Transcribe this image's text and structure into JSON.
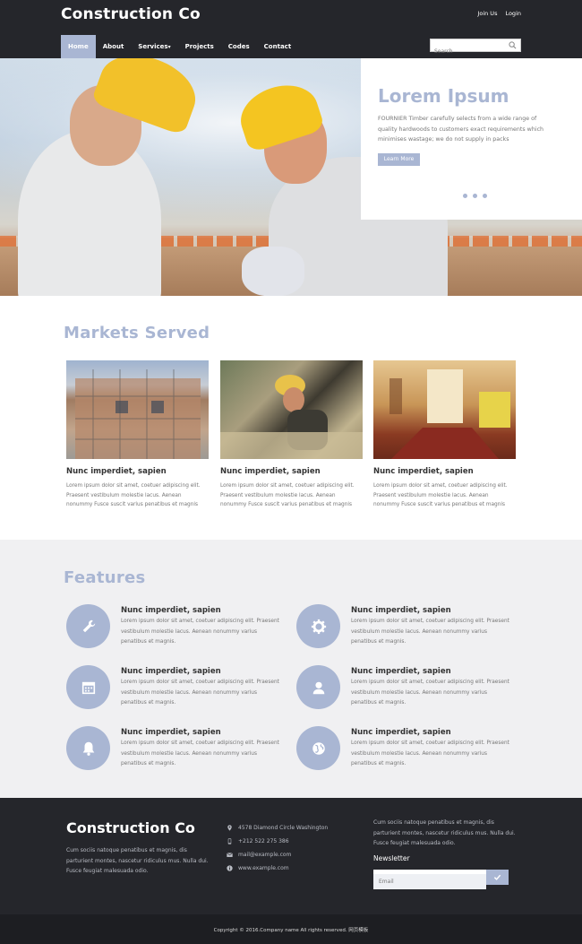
{
  "header": {
    "brand": "Construction Co",
    "top_links": [
      "Join Us",
      "Login"
    ],
    "nav": [
      "Home",
      "About",
      "Services",
      "Projects",
      "Codes",
      "Contact"
    ],
    "nav_active": "Home",
    "services_caret": "▾",
    "search_placeholder": "Search"
  },
  "hero": {
    "title": "Lorem Ipsum",
    "text": "FOURNIER Timber carefully selects from a wide range of quality hardwoods to customers exact requirements which minimises wastage; we do not supply in packs",
    "button": "Learn More",
    "slide_count": 3
  },
  "markets": {
    "title": "Markets Served",
    "cards": [
      {
        "title": "Nunc imperdiet, sapien",
        "text": "Lorem ipsum dolor sit amet, coetuer adipiscing elit. Praesent vestibulum molestie lacus. Aenean nonummy Fusce suscit varius penatibus et magnis"
      },
      {
        "title": "Nunc imperdiet, sapien",
        "text": "Lorem ipsum dolor sit amet, coetuer adipiscing elit. Praesent vestibulum molestie lacus. Aenean nonummy Fusce suscit varius penatibus et magnis"
      },
      {
        "title": "Nunc imperdiet, sapien",
        "text": "Lorem ipsum dolor sit amet, coetuer adipiscing elit. Praesent vestibulum molestie lacus. Aenean nonummy Fusce suscit varius penatibus et magnis"
      }
    ]
  },
  "features": {
    "title": "Features",
    "items": [
      {
        "icon": "wrench-icon",
        "title": "Nunc imperdiet, sapien",
        "text": "Lorem ipsum dolor sit amet, coetuer adipiscing elit. Praesent vestibulum molestie lacus. Aenean nonummy varius penatibus et magnis."
      },
      {
        "icon": "gear-icon",
        "title": "Nunc imperdiet, sapien",
        "text": "Lorem ipsum dolor sit amet, coetuer adipiscing elit. Praesent vestibulum molestie lacus. Aenean nonummy varius penatibus et magnis."
      },
      {
        "icon": "calendar-icon",
        "title": "Nunc imperdiet, sapien",
        "text": "Lorem ipsum dolor sit amet, coetuer adipiscing elit. Praesent vestibulum molestie lacus. Aenean nonummy varius penatibus et magnis."
      },
      {
        "icon": "user-icon",
        "title": "Nunc imperdiet, sapien",
        "text": "Lorem ipsum dolor sit amet, coetuer adipiscing elit. Praesent vestibulum molestie lacus. Aenean nonummy varius penatibus et magnis."
      },
      {
        "icon": "bell-icon",
        "title": "Nunc imperdiet, sapien",
        "text": "Lorem ipsum dolor sit amet, coetuer adipiscing elit. Praesent vestibulum molestie lacus. Aenean nonummy varius penatibus et magnis."
      },
      {
        "icon": "globe-icon",
        "title": "Nunc imperdiet, sapien",
        "text": "Lorem ipsum dolor sit amet, coetuer adipiscing elit. Praesent vestibulum molestie lacus. Aenean nonummy varius penatibus et magnis."
      }
    ]
  },
  "footer": {
    "brand": "Construction Co",
    "description": "Cum sociis natoque penatibus et magnis, dis parturient montes, nascetur ridiculus mus. Nulla dui. Fusce feugiat malesuada odio.",
    "address": "4578 Diamond Circle Washington",
    "phone": "+212 522 275 386",
    "email": "mail@example.com",
    "website": "www.example.com",
    "right_text": "Cum sociis natoque penatibus et magnis, dis parturient montes, nascetur ridiculus mus. Nulla dui. Fusce feugiat malesuada odio.",
    "newsletter_label": "Newsletter",
    "newsletter_placeholder": "Email",
    "copyright": "Copyright © 2016.Company name All rights reserved. 网页模板"
  },
  "colors": {
    "accent": "#a9b6d3",
    "dark": "#25262b",
    "features_bg": "#f0f0f2"
  }
}
